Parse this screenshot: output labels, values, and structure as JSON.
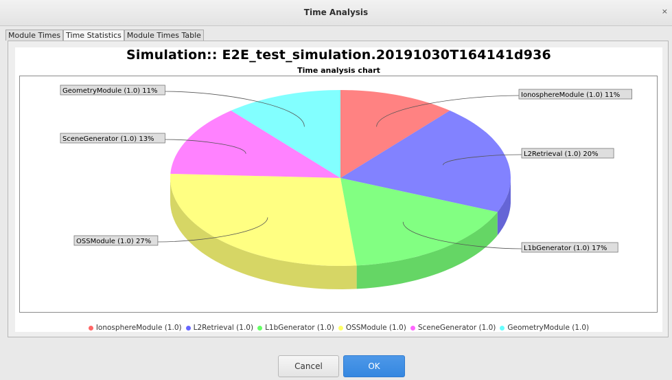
{
  "window": {
    "title": "Time Analysis",
    "close_glyph": "×"
  },
  "tabs": [
    {
      "label": "Module Times",
      "active": false
    },
    {
      "label": "Time Statistics",
      "active": true
    },
    {
      "label": "Module Times Table",
      "active": false
    }
  ],
  "chart_data": {
    "type": "pie",
    "title": "Simulation:: E2E_test_simulation.20191030T164141d936",
    "subtitle": "Time analysis chart",
    "slices": [
      {
        "name": "IonosphereModule (1.0)",
        "label": "IonosphereModule (1.0) 11%",
        "value": 11,
        "color": "#ff6666"
      },
      {
        "name": "L2Retrieval (1.0)",
        "label": "L2Retrieval (1.0) 20%",
        "value": 20,
        "color": "#6666ff"
      },
      {
        "name": "L1bGenerator (1.0)",
        "label": "L1bGenerator (1.0) 17%",
        "value": 17,
        "color": "#66ff66"
      },
      {
        "name": "OSSModule (1.0)",
        "label": "OSSModule (1.0) 27%",
        "value": 27,
        "color": "#ffff66"
      },
      {
        "name": "SceneGenerator (1.0)",
        "label": "SceneGenerator (1.0) 13%",
        "value": 13,
        "color": "#ff66ff"
      },
      {
        "name": "GeometryModule (1.0)",
        "label": "GeometryModule (1.0) 11%",
        "value": 11,
        "color": "#66ffff"
      }
    ],
    "legend_placement": "bottom"
  },
  "buttons": {
    "cancel_label": "Cancel",
    "ok_label": "OK"
  }
}
